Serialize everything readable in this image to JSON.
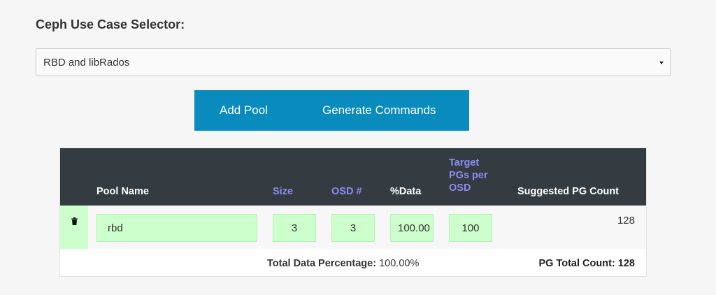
{
  "selector": {
    "label": "Ceph Use Case Selector:",
    "selected": "RBD and libRados"
  },
  "buttons": {
    "add_pool": "Add Pool",
    "generate_commands": "Generate Commands"
  },
  "table": {
    "headers": {
      "pool_name": "Pool Name",
      "size": "Size",
      "osd": "OSD #",
      "data": "%Data",
      "target_line1": "Target",
      "target_line2": "PGs per",
      "target_line3": "OSD",
      "suggested": "Suggested PG Count"
    },
    "rows": [
      {
        "pool_name": "rbd",
        "size": "3",
        "osd": "3",
        "data": "100.00",
        "target_pgs": "100",
        "suggested": "128"
      }
    ],
    "footer": {
      "total_data_label": "Total Data Percentage:",
      "total_data_value": "100.00%",
      "pg_total_label": "PG Total Count:",
      "pg_total_value": "128"
    }
  },
  "colors": {
    "button_bg": "#0a8bbd",
    "header_bg": "#343c42",
    "header_accent": "#8e8cf0",
    "input_bg": "#ccffcc"
  },
  "icons": {
    "select_caret": "caret-down-icon",
    "delete": "trash-icon"
  }
}
